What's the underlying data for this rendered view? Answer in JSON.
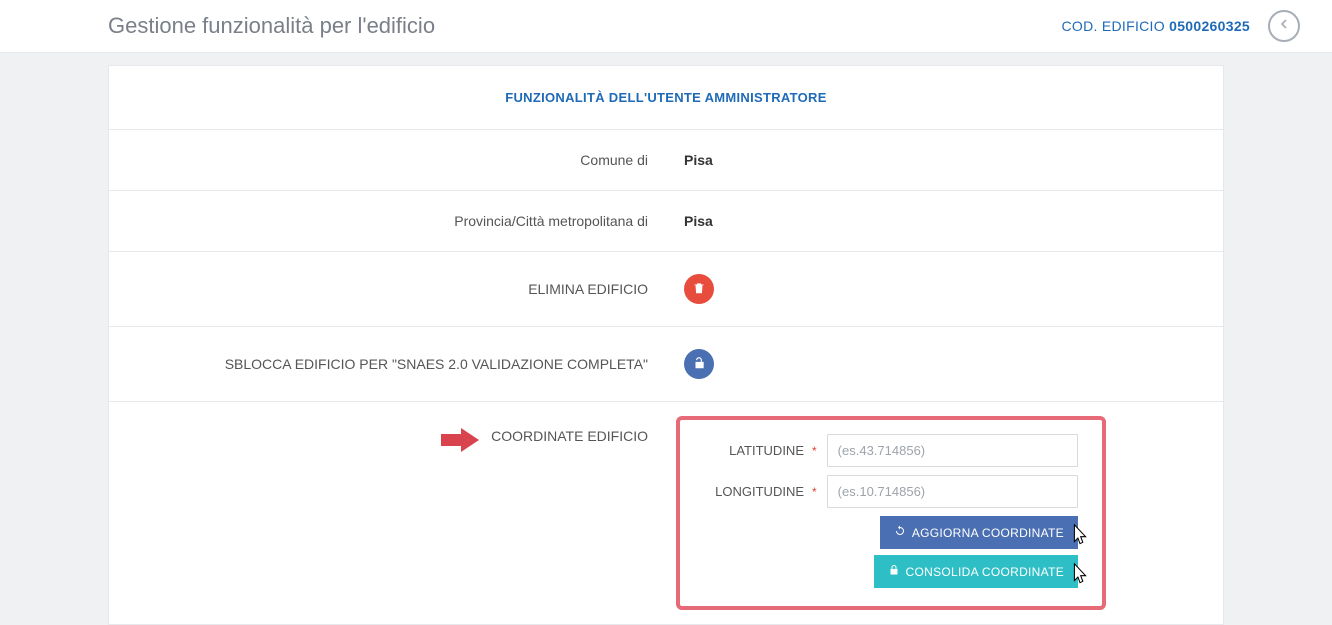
{
  "header": {
    "title": "Gestione funzionalità per l'edificio",
    "cod_label": "COD. EDIFICIO ",
    "cod_value": "0500260325"
  },
  "panel": {
    "heading": "FUNZIONALITÀ DELL'UTENTE AMMINISTRATORE",
    "rows": {
      "comune_label": "Comune di",
      "comune_value": "Pisa",
      "provincia_label": "Provincia/Città metropolitana di",
      "provincia_value": "Pisa",
      "elimina_label": "ELIMINA EDIFICIO",
      "sblocca_label": "SBLOCCA EDIFICIO PER \"SNAES 2.0 VALIDAZIONE COMPLETA\"",
      "coordinate_label": "COORDINATE EDIFICIO"
    },
    "coordinate_form": {
      "lat_label": "LATITUDINE",
      "lat_placeholder": "(es.43.714856)",
      "lon_label": "LONGITUDINE",
      "lon_placeholder": "(es.10.714856)",
      "aggiorna_label": "AGGIORNA COORDINATE",
      "consolida_label": "CONSOLIDA COORDINATE"
    }
  }
}
